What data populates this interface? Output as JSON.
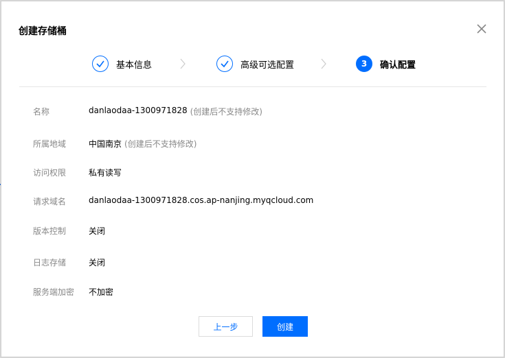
{
  "dialog": {
    "title": "创建存储桶"
  },
  "steps": [
    {
      "label": "基本信息",
      "status": "done",
      "icon": "check-icon"
    },
    {
      "label": "高级可选配置",
      "status": "done",
      "icon": "check-icon"
    },
    {
      "label": "确认配置",
      "status": "active",
      "number": "3"
    }
  ],
  "summary": [
    {
      "label": "名称",
      "value": "danlaodaa-1300971828",
      "note": "(创建后不支持修改)"
    },
    {
      "label": "所属地域",
      "value": "中国南京",
      "note": "(创建后不支持修改)"
    },
    {
      "label": "访问权限",
      "value": "私有读写",
      "note": ""
    },
    {
      "label": "请求域名",
      "value": "danlaodaa-1300971828.cos.ap-nanjing.myqcloud.com",
      "note": ""
    },
    {
      "label": "版本控制",
      "value": "关闭",
      "note": ""
    },
    {
      "label": "日志存储",
      "value": "关闭",
      "note": ""
    },
    {
      "label": "服务端加密",
      "value": "不加密",
      "note": ""
    }
  ],
  "buttons": {
    "prev_label": "上一步",
    "create_label": "创建"
  },
  "colors": {
    "primary": "#006eff",
    "label_gray": "#888888",
    "divider": "#e5e5e5"
  }
}
